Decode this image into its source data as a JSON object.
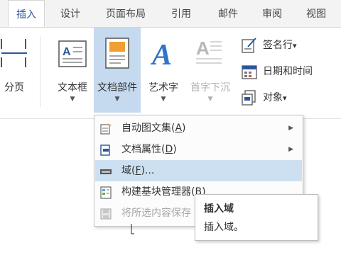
{
  "tabs": [
    {
      "label": "插入",
      "active": true
    },
    {
      "label": "设计"
    },
    {
      "label": "页面布局"
    },
    {
      "label": "引用"
    },
    {
      "label": "邮件"
    },
    {
      "label": "审阅"
    },
    {
      "label": "视图"
    }
  ],
  "ribbon": {
    "page_break": {
      "label": "分页",
      "icon": "page-break-icon"
    },
    "text_box": {
      "label": "文本框",
      "arrow": "▼",
      "icon": "text-box-icon"
    },
    "quick_parts": {
      "label": "文档部件",
      "arrow": "▼",
      "icon": "quick-parts-icon",
      "pressed": true
    },
    "wordart": {
      "label": "艺术字",
      "arrow": "▼",
      "icon": "wordart-icon"
    },
    "drop_cap": {
      "label": "首字下沉",
      "arrow": "▼",
      "icon": "drop-cap-icon",
      "disabled": true
    },
    "signature_line": {
      "label": "签名行",
      "arrow": "▾",
      "icon": "signature-line-icon"
    },
    "date_time": {
      "label": "日期和时间",
      "icon": "calendar-icon"
    },
    "object": {
      "label": "对象",
      "arrow": "▾",
      "icon": "object-icon"
    }
  },
  "menu": {
    "items": [
      {
        "label": "自动图文集(",
        "key": "A",
        "end": ")",
        "submenu": "▶",
        "icon": "autotext-icon"
      },
      {
        "label": "文档属性(",
        "key": "D",
        "end": ")",
        "submenu": "▶",
        "icon": "document-property-icon"
      },
      {
        "label": "域(",
        "key": "F",
        "end": ")...",
        "icon": "field-icon",
        "highlighted": true
      },
      {
        "label": "构建基块管理器(B)",
        "icon": "building-blocks-icon"
      },
      {
        "label": "将所选内容保存",
        "icon": "save-selection-icon",
        "disabled": true
      }
    ]
  },
  "tooltip": {
    "title": "插入域",
    "description": "插入域。"
  },
  "colors": {
    "accent": "#2b579a",
    "pressed": "#c5d9ef",
    "hover": "#cde0f1",
    "wordart_blue": "#2f75c9"
  }
}
